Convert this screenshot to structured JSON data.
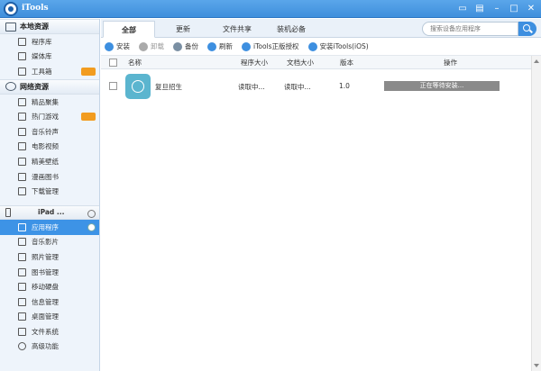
{
  "window": {
    "title": "iTools"
  },
  "titlebar_buttons": [
    "feedback",
    "restore",
    "minimize",
    "maximize",
    "close"
  ],
  "sidebar": {
    "local_header": "本地资源",
    "local_items": [
      "程序库",
      "媒体库",
      "工具箱"
    ],
    "network_header": "网络资源",
    "network_items": [
      "精品聚集",
      "热门游戏",
      "音乐铃声",
      "电影视频",
      "精美壁纸",
      "漫画图书",
      "下载管理"
    ],
    "device_name": "iPad ...",
    "device_items": [
      "应用程序",
      "音乐影片",
      "照片管理",
      "图书管理",
      "移动硬盘",
      "信息管理",
      "桌面管理",
      "文件系统",
      "高级功能"
    ]
  },
  "tabs": [
    "全部",
    "更新",
    "文件共享",
    "装机必备"
  ],
  "search": {
    "placeholder": "搜索设备应用程序"
  },
  "toolbar": {
    "install": "安装",
    "uninstall": "卸载",
    "backup": "备份",
    "refresh": "刷新",
    "genuine": "iTools正版授权",
    "install_itools": "安装iTools(iOS)"
  },
  "table": {
    "headers": {
      "name": "名称",
      "size": "程序大小",
      "docsize": "文档大小",
      "version": "版本",
      "action": "操作"
    },
    "rows": [
      {
        "name": "复旦招生",
        "size": "读取中...",
        "docsize": "读取中...",
        "version": "1.0",
        "status": "正在等待安装..."
      }
    ]
  },
  "colors": {
    "accent": "#3d93e6",
    "title_bar": "#4a9ae4",
    "badge": "#f29c1f"
  }
}
